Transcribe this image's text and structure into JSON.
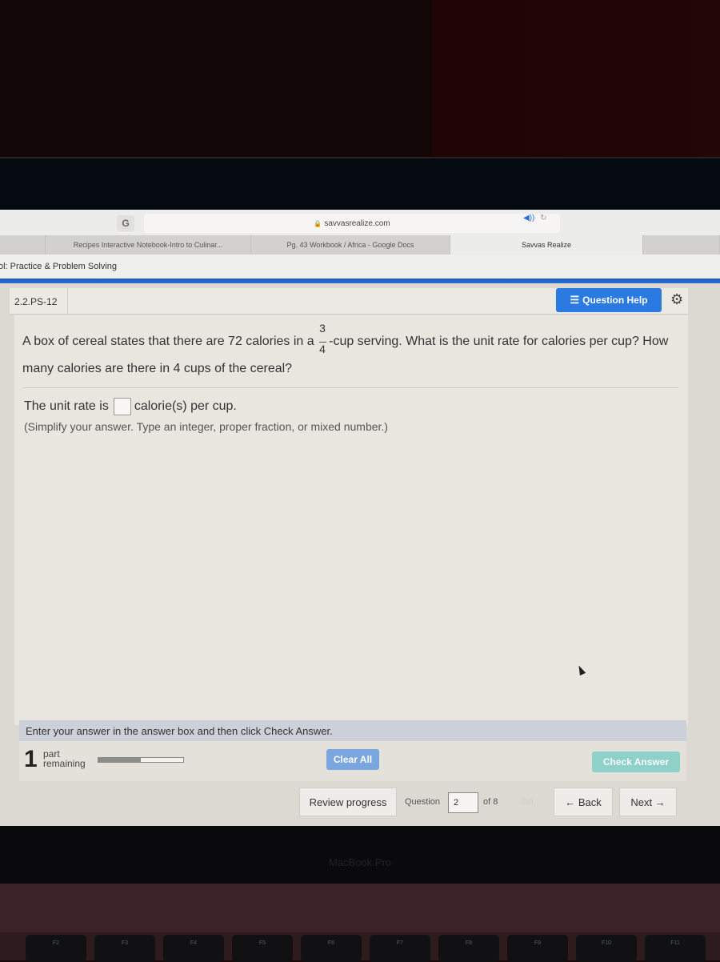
{
  "browser": {
    "url": "savvasrealize.com",
    "tabs": [
      {
        "label": "Recipes Interactive Notebook-Intro to Culinar...",
        "active": false
      },
      {
        "label": "Pg. 43 Workbook / Africa - Google Docs",
        "active": false
      },
      {
        "label": "Savvas Realize",
        "active": true
      }
    ],
    "page_heading": "ol: Practice & Problem Solving"
  },
  "question": {
    "id": "2.2.PS-12",
    "help_label": "Question Help",
    "text_part1": "A box of cereal states that there are 72 calories in a",
    "fraction": {
      "numerator": "3",
      "denominator": "4"
    },
    "text_part2": "-cup serving. What is the unit rate for calories per cup? How many calories are there in 4 cups of the cereal?",
    "answer_prefix": "The unit rate is",
    "answer_value": "",
    "answer_suffix": "calorie(s) per cup.",
    "hint": "(Simplify your answer. Type an integer, proper fraction, or mixed number.)"
  },
  "instructions": "Enter your answer in the answer box and then click Check Answer.",
  "footer": {
    "parts_count": "1",
    "parts_label_line1": "part",
    "parts_label_line2": "remaining",
    "progress_fraction": 0.5,
    "clear_label": "Clear All",
    "check_label": "Check Answer"
  },
  "nav": {
    "review_label": "Review progress",
    "question_label": "Question",
    "question_number": "2",
    "of_label": "of 8",
    "go_label": "Go",
    "back_label": "← Back",
    "next_label": "Next →"
  },
  "laptop": {
    "brand": "MacBook Pro",
    "keys": [
      "F2",
      "F3",
      "F4",
      "F5",
      "F6",
      "F7",
      "F8",
      "F9",
      "F10",
      "F11"
    ]
  },
  "colors": {
    "accent_blue": "#2a7ae2",
    "check_teal": "#8fd0c8",
    "clear_blue": "#7aa6e0"
  }
}
